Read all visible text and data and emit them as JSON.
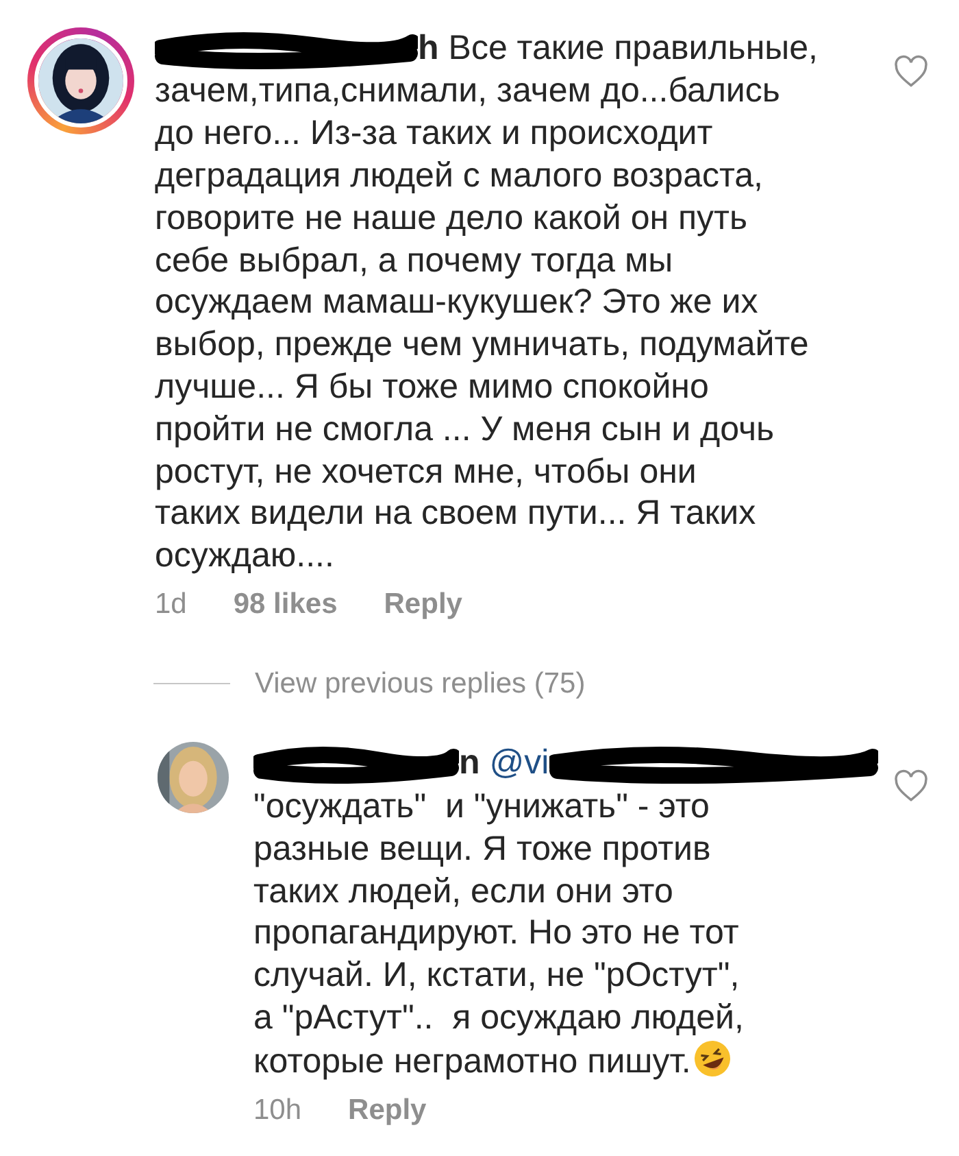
{
  "comments": [
    {
      "avatar": {
        "story_ring": true
      },
      "username": "h",
      "text": "Все такие правильные,\nзачем,типа,снимали, зачем до...бались\nдо него... Из-за таких и происходит\nдеградация людей с малого возраста,\nговорите не наше дело какой он путь\nсебе выбрал, а почему тогда мы\nосуждаем мамаш-кукушек? Это же их\nвыбор, прежде чем умничать, подумайте\nлучше... Я бы тоже мимо спокойно\nпройти не смогла ... У меня сын и дочь\nростут, не хочется мне, чтобы они\nтаких видели на своем пути... Я таких\nосуждаю....",
      "liked": false,
      "time": "1d",
      "likes": "98 likes",
      "reply": "Reply"
    }
  ],
  "view_replies": "View previous replies (75)",
  "replies": [
    {
      "avatar": {
        "story_ring": false
      },
      "username": "n",
      "mention": "@vi",
      "text": "\"осуждать\"  и \"унижать\" - это\nразные вещи. Я тоже против\nтаких людей, если они это\nпропагандируют. Но это не тот\nслучай. И, кстати, не \"рОстут\",\nа \"рАстут\"..  я осуждаю людей,\nкоторые неграмотно пишут.",
      "laughing_emoji": true,
      "liked": false,
      "time": "10h",
      "reply": "Reply"
    }
  ]
}
